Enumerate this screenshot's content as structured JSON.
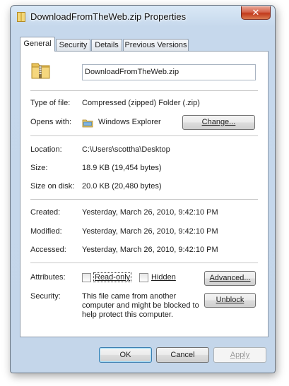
{
  "window": {
    "title": "DownloadFromTheWeb.zip Properties",
    "close_glyph": "✕"
  },
  "tabs": [
    {
      "label": "General",
      "active": true
    },
    {
      "label": "Security",
      "active": false
    },
    {
      "label": "Details",
      "active": false
    },
    {
      "label": "Previous Versions",
      "active": false
    }
  ],
  "general": {
    "file_name": "DownloadFromTheWeb.zip",
    "type_label": "Type of file:",
    "type_value": "Compressed (zipped) Folder (.zip)",
    "opens_label": "Opens with:",
    "opens_value": "Windows Explorer",
    "change_button": "Change...",
    "location_label": "Location:",
    "location_value": "C:\\Users\\scottha\\Desktop",
    "size_label": "Size:",
    "size_value": "18.9 KB (19,454 bytes)",
    "size_on_disk_label": "Size on disk:",
    "size_on_disk_value": "20.0 KB (20,480 bytes)",
    "created_label": "Created:",
    "created_value": "Yesterday, March 26, 2010, 9:42:10 PM",
    "modified_label": "Modified:",
    "modified_value": "Yesterday, March 26, 2010, 9:42:10 PM",
    "accessed_label": "Accessed:",
    "accessed_value": "Yesterday, March 26, 2010, 9:42:10 PM",
    "attributes_label": "Attributes:",
    "readonly_label": "Read-only",
    "hidden_label": "Hidden",
    "advanced_button": "Advanced...",
    "security_label": "Security:",
    "security_text": "This file came from another computer and might be blocked to help protect this computer.",
    "unblock_button": "Unblock"
  },
  "footer": {
    "ok": "OK",
    "cancel": "Cancel",
    "apply": "Apply"
  }
}
